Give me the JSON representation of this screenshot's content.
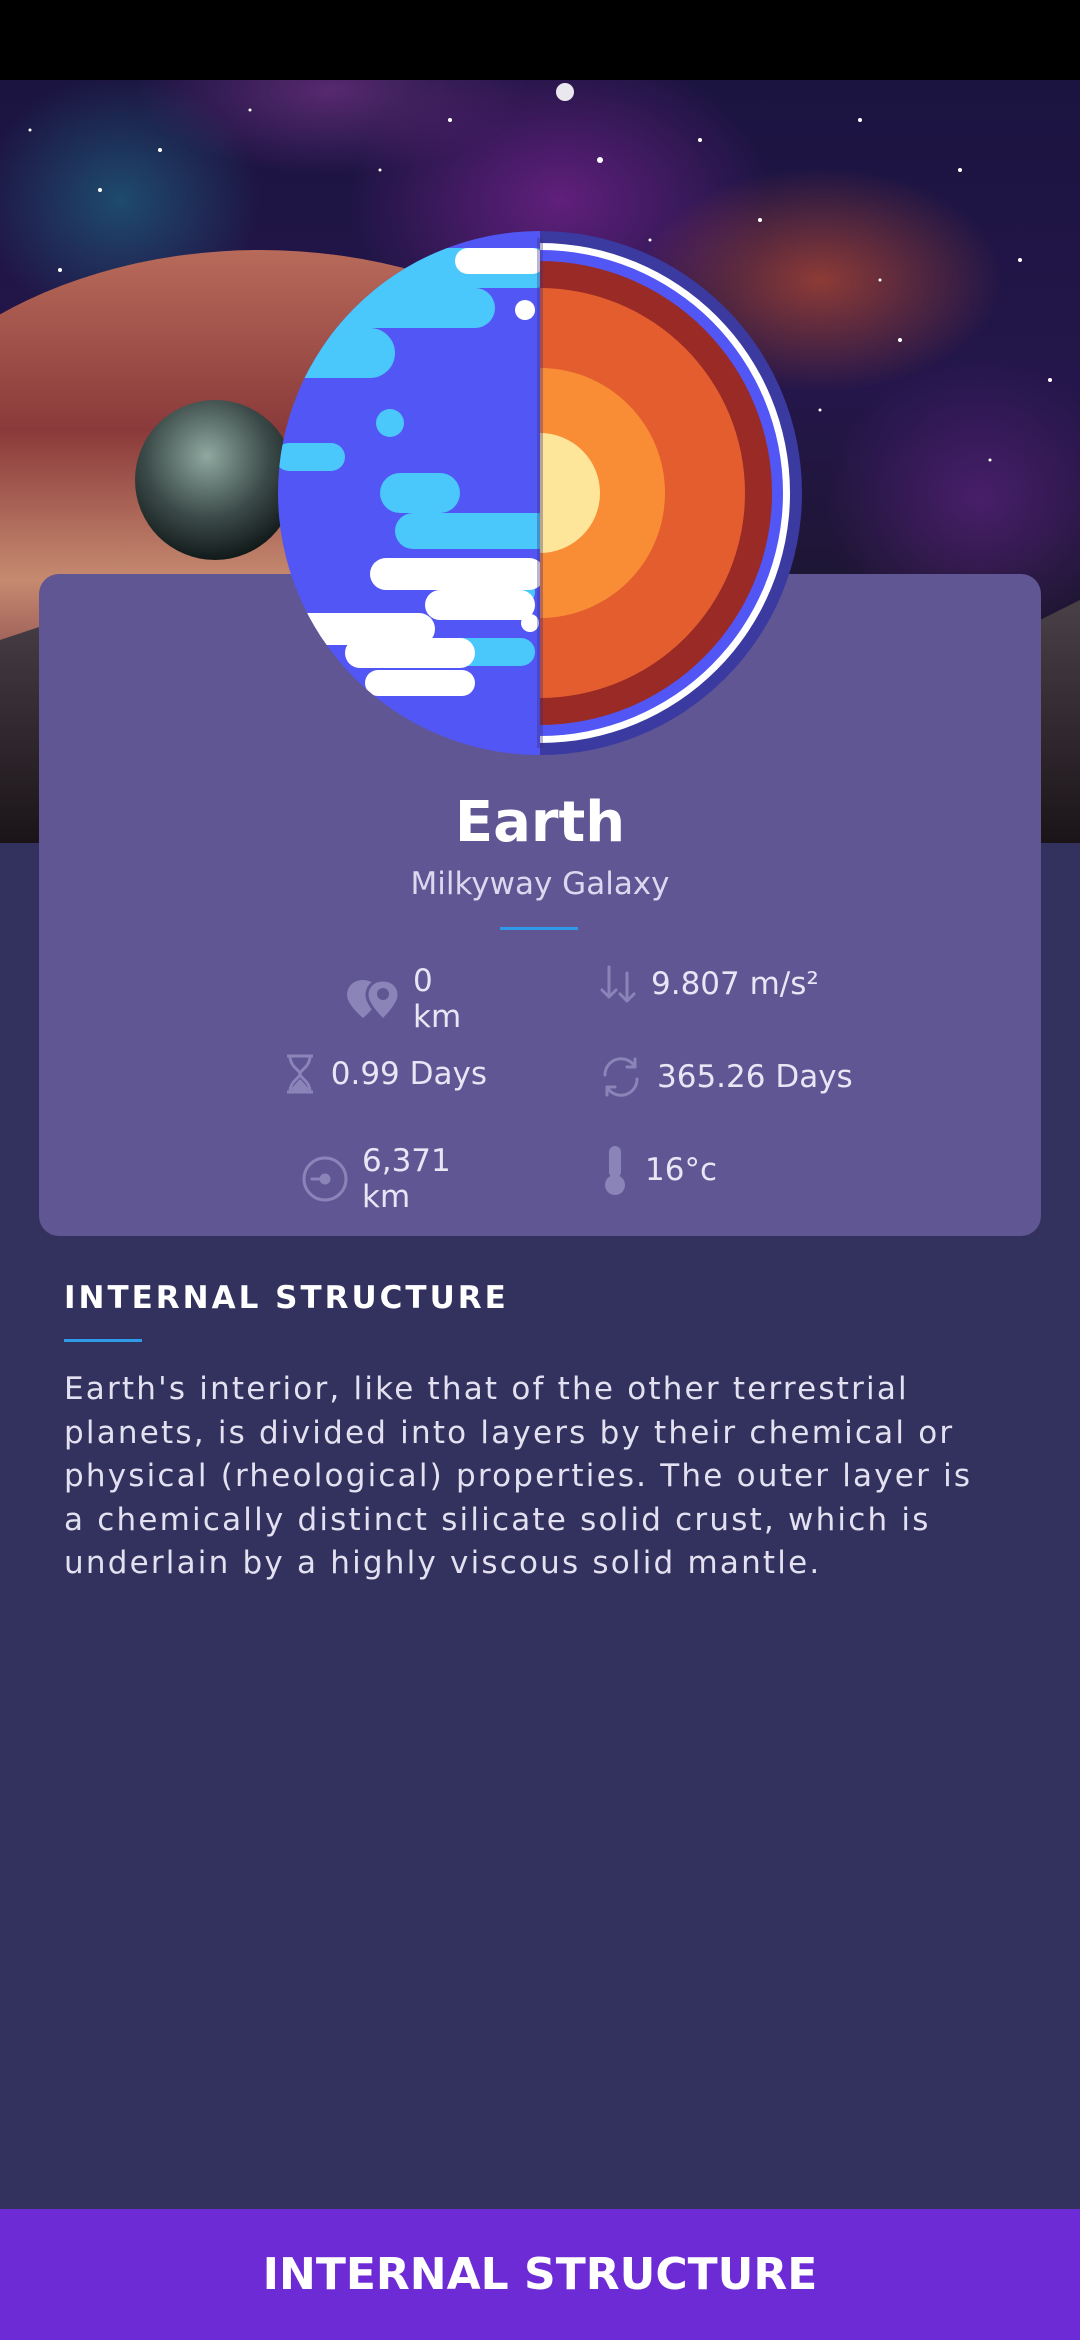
{
  "planet": {
    "name": "Earth",
    "galaxy": "Milkyway Galaxy"
  },
  "stats": [
    {
      "icon": "location-pins-icon",
      "value": "0 km"
    },
    {
      "icon": "gravity-arrows-down-icon",
      "value": "9.807 m/s²"
    },
    {
      "icon": "hourglass-icon",
      "value": "0.99 Days"
    },
    {
      "icon": "orbit-cycle-icon",
      "value": "365.26 Days"
    },
    {
      "icon": "radius-icon",
      "value": "6,371 km"
    },
    {
      "icon": "thermometer-icon",
      "value": "16°c"
    }
  ],
  "section": {
    "title": "INTERNAL STRUCTURE",
    "body": "Earth's interior, like that of the other terrestrial planets, is divided into layers by their chemical or physical (rheological) properties. The outer layer is a chemically distinct silicate solid crust, which is underlain by a highly viscous solid mantle."
  },
  "bottom_button": {
    "label": "INTERNAL STRUCTURE"
  },
  "colors": {
    "background": "#33325f",
    "card": "#5f5693",
    "accent_divider": "#2f9be8",
    "button": "#6d2bd6"
  }
}
